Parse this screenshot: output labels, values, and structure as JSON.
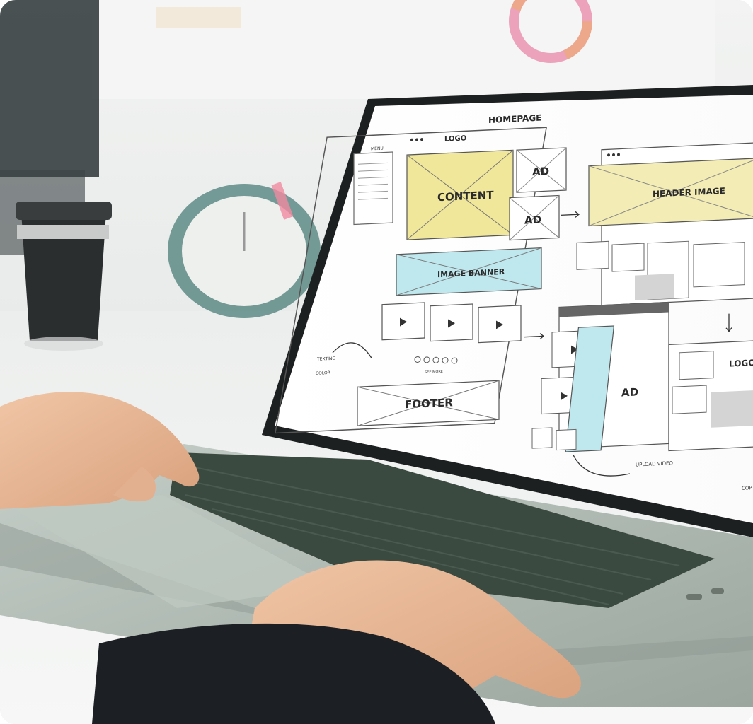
{
  "scene": {
    "description_tags": [
      "laptop",
      "typing-hands",
      "website-wireframe",
      "coffee-cup",
      "desk-clock"
    ],
    "colors": {
      "content_fill": "#f1e79a",
      "banner_fill": "#bfe7ee",
      "header_image_fill": "#f3ecb4",
      "ad_tall_fill": "#bfe7ee",
      "keyboard": "#3b4a40",
      "laptop_body": "#a9b6ad"
    }
  },
  "wireframe": {
    "page_title": "HOMEPAGE",
    "logo": "LOGO",
    "menu": "MENU",
    "content": "CONTENT",
    "ad_1": "AD",
    "ad_2": "AD",
    "image_banner": "IMAGE BANNER",
    "footer": "FOOTER",
    "header_image": "HEADER IMAGE",
    "ad_tall": "AD",
    "logo_right": "LOGO",
    "upload_video": "UPLOAD VIDEO",
    "copy_fragment": "COP",
    "pagination_label": "SEE MORE",
    "checklist_1": "TEXTING",
    "checklist_2": "COLOR"
  }
}
